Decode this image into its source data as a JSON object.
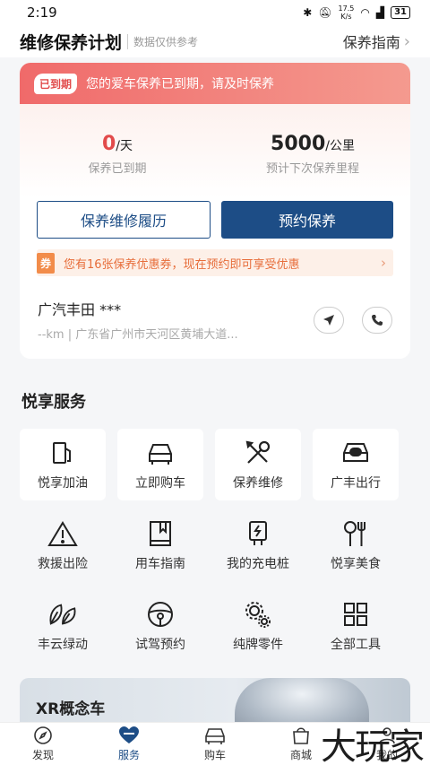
{
  "status_bar": {
    "time": "2:19",
    "net_speed_top": "17.5",
    "net_speed_bottom": "K/s",
    "battery": "31"
  },
  "header": {
    "title": "维修保养计划",
    "subtitle": "数据仅供参考",
    "guide_label": "保养指南"
  },
  "alert": {
    "badge": "已到期",
    "message": "您的爱车保养已到期，请及时保养"
  },
  "stats": {
    "days_value": "0",
    "days_unit": "/天",
    "days_label": "保养已到期",
    "mileage_value": "5000",
    "mileage_unit": "/公里",
    "mileage_label": "预计下次保养里程"
  },
  "buttons": {
    "history_label": "保养维修履历",
    "book_label": "预约保养"
  },
  "coupon": {
    "tag": "券",
    "text": "您有16张保养优惠券，现在预约即可享受优惠"
  },
  "dealer": {
    "name": "广汽丰田 ***",
    "address": "--km | 广东省广州市天河区黄埔大道..."
  },
  "services_title": "悦享服务",
  "services": [
    {
      "label": "悦享加油",
      "icon": "fuel-pump-icon"
    },
    {
      "label": "立即购车",
      "icon": "car-front-icon"
    },
    {
      "label": "保养维修",
      "icon": "tools-icon"
    },
    {
      "label": "广丰出行",
      "icon": "car-share-icon"
    },
    {
      "label": "救援出险",
      "icon": "warning-icon"
    },
    {
      "label": "用车指南",
      "icon": "book-icon"
    },
    {
      "label": "我的充电桩",
      "icon": "charger-icon"
    },
    {
      "label": "悦享美食",
      "icon": "cutlery-icon"
    },
    {
      "label": "丰云绿动",
      "icon": "leaf-icon"
    },
    {
      "label": "试驾预约",
      "icon": "steering-wheel-icon"
    },
    {
      "label": "纯牌零件",
      "icon": "gears-icon"
    },
    {
      "label": "全部工具",
      "icon": "grid-icon"
    }
  ],
  "promo": {
    "title": "XR概念车"
  },
  "tabs": [
    {
      "label": "发现",
      "icon": "compass-icon"
    },
    {
      "label": "服务",
      "icon": "heart-icon"
    },
    {
      "label": "购车",
      "icon": "car-icon"
    },
    {
      "label": "商城",
      "icon": "shop-icon"
    },
    {
      "label": "我的",
      "icon": "user-icon"
    }
  ],
  "watermark": "大玩家",
  "colors": {
    "brand_blue": "#1d4d86",
    "alert_red": "#e24b4b",
    "coupon_orange": "#f28c4a"
  }
}
